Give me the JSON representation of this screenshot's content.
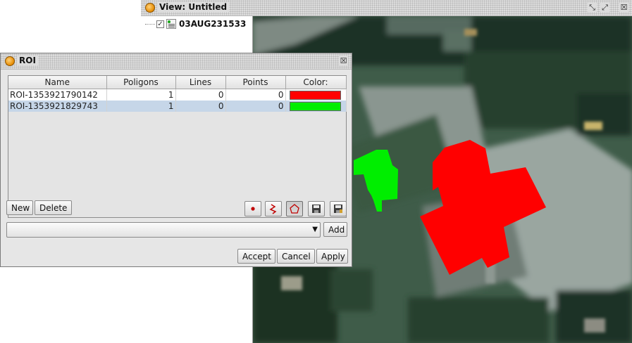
{
  "view_window": {
    "title": "View: Untitled",
    "buttons": {
      "restore": "⤡",
      "maximize": "⤢",
      "close": "☒"
    },
    "layer_tree": {
      "layer_name": "03AUG231533",
      "checked": true,
      "check_glyph": "✓"
    }
  },
  "roi_dialog": {
    "title": "ROI",
    "close_glyph": "☒",
    "columns": [
      "Name",
      "Poligons",
      "Lines",
      "Points",
      "Color:"
    ],
    "rows": [
      {
        "name": "ROI-1353921790142",
        "polygons": "1",
        "lines": "0",
        "points": "0",
        "color": "#ff0000",
        "selected": false
      },
      {
        "name": "ROI-1353921829743",
        "polygons": "1",
        "lines": "0",
        "points": "0",
        "color": "#00ee00",
        "selected": true
      }
    ],
    "buttons": {
      "new": "New",
      "delete": "Delete",
      "add": "Add",
      "accept": "Accept",
      "cancel": "Cancel",
      "apply": "Apply"
    },
    "tools": [
      {
        "name": "point-tool",
        "icon": "point-icon",
        "pressed": false
      },
      {
        "name": "line-tool",
        "icon": "polyline-icon",
        "pressed": false
      },
      {
        "name": "polygon-tool",
        "icon": "polygon-icon",
        "pressed": true
      },
      {
        "name": "save-tool",
        "icon": "save-icon",
        "pressed": false
      },
      {
        "name": "save-as-tool",
        "icon": "save-as-icon",
        "pressed": false
      }
    ],
    "combo": {
      "selected_value": "",
      "arrow_glyph": "▼"
    }
  },
  "colors": {
    "roi_red": "#ff0000",
    "roi_green": "#00ee00",
    "selection": "#c6d6e8"
  }
}
